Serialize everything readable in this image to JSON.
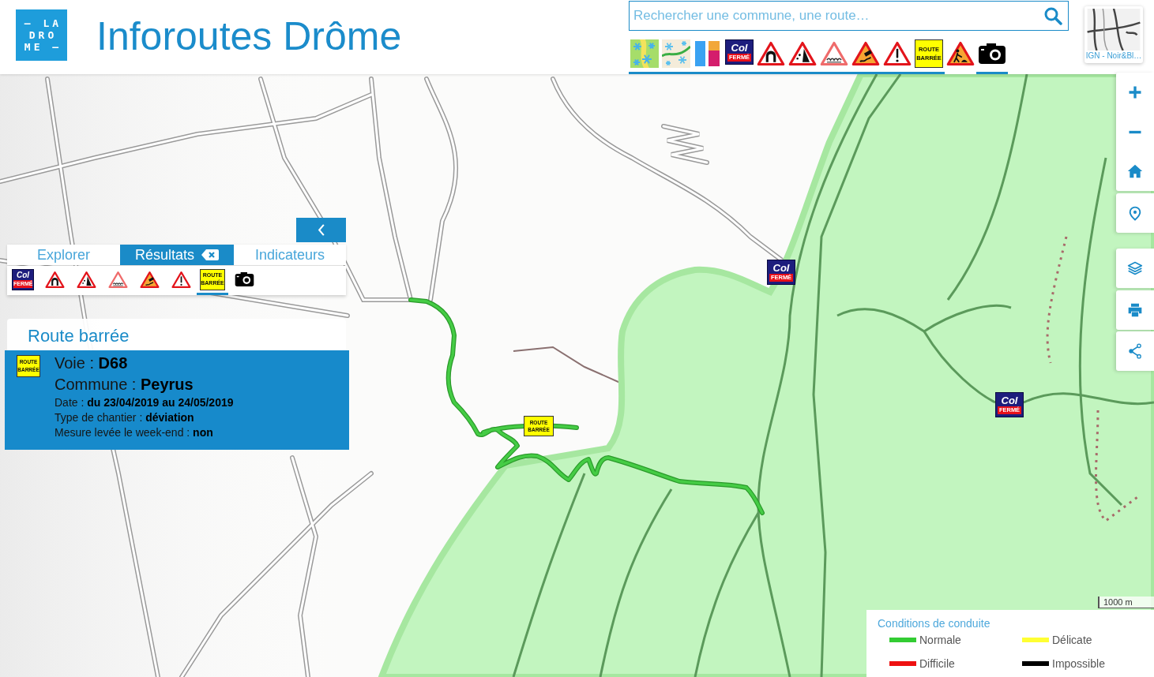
{
  "header": {
    "logo": [
      "– LA",
      "DRO",
      "ME –"
    ],
    "title": "Inforoutes Drôme"
  },
  "search": {
    "placeholder": "Rechercher une commune, une route…"
  },
  "layers": [
    {
      "kind": "snow_zones",
      "selected": true
    },
    {
      "kind": "snow_routes",
      "selected": true
    },
    {
      "kind": "color_bars",
      "selected": true
    },
    {
      "kind": "col_closed",
      "lines": [
        "Col",
        "FERMÉ"
      ],
      "selected": true
    },
    {
      "kind": "tunnel",
      "selected": true
    },
    {
      "kind": "falling_rocks",
      "selected": true
    },
    {
      "kind": "uneven_road",
      "selected": true
    },
    {
      "kind": "slippery_road",
      "selected": true
    },
    {
      "kind": "danger",
      "selected": true
    },
    {
      "kind": "road_closed",
      "lines": [
        "ROUTE",
        "BARRÉE"
      ],
      "selected": true
    },
    {
      "kind": "roadworks",
      "selected": false
    },
    {
      "kind": "camera",
      "selected": true
    }
  ],
  "basemap": {
    "caption": "IGN - Noir&Bl…"
  },
  "panel": {
    "tabs": [
      {
        "label": "Explorer",
        "selected": false,
        "clearable": false
      },
      {
        "label": "Résultats",
        "selected": true,
        "clearable": true
      },
      {
        "label": "Indicateurs",
        "selected": false,
        "clearable": false
      }
    ],
    "filters": [
      {
        "kind": "col_closed",
        "lines": [
          "Col",
          "FERMÉ"
        ],
        "selected": false
      },
      {
        "kind": "tunnel",
        "selected": false
      },
      {
        "kind": "falling_rocks",
        "selected": false
      },
      {
        "kind": "uneven_road",
        "selected": false
      },
      {
        "kind": "slippery_road",
        "selected": false
      },
      {
        "kind": "danger",
        "selected": false
      },
      {
        "kind": "road_closed",
        "lines": [
          "ROUTE",
          "BARRÉE"
        ],
        "selected": true
      },
      {
        "kind": "camera",
        "selected": false
      }
    ]
  },
  "result": {
    "title": "Route barrée",
    "sign": {
      "kind": "road_closed",
      "lines": [
        "ROUTE",
        "BARRÉE"
      ]
    },
    "fields": [
      {
        "kind": "main",
        "text": "Voie : **D68**"
      },
      {
        "kind": "main",
        "text": "Commune : **Peyrus**"
      },
      {
        "kind": "detail",
        "text": "Date : **du 23/04/2019 au 24/05/2019**"
      },
      {
        "kind": "detail",
        "text": "Type de chantier : **déviation**"
      },
      {
        "kind": "detail",
        "text": "Mesure levée le week-end : **non**"
      }
    ]
  },
  "map": {
    "markers": [
      {
        "kind": "col_closed",
        "lines": [
          "Col",
          "FERMÉ"
        ]
      },
      {
        "kind": "road_closed",
        "lines": [
          "ROUTE",
          "BARRÉE"
        ]
      },
      {
        "kind": "col_closed",
        "lines": [
          "Col",
          "FERMÉ"
        ]
      }
    ],
    "scale": "1000 m"
  },
  "legend": {
    "title": "Conditions de conduite",
    "items": [
      {
        "label": "Normale",
        "color": "#33cc33"
      },
      {
        "label": "Délicate",
        "color": "#ffff33"
      },
      {
        "label": "Difficile",
        "color": "#ee1111"
      },
      {
        "label": "Impossible",
        "color": "#000000"
      }
    ]
  }
}
